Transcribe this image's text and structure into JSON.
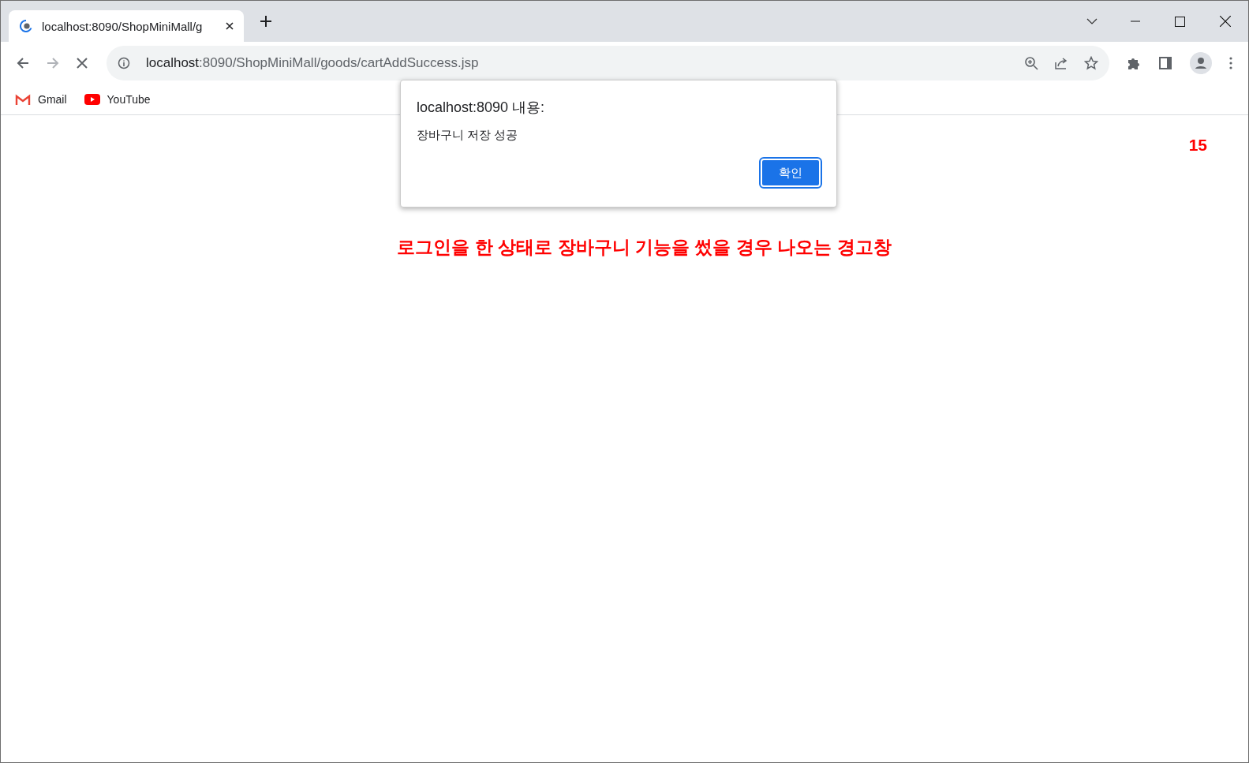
{
  "tabs": [
    {
      "title": "localhost:8090/ShopMiniMall/g",
      "selected": true
    }
  ],
  "address_bar": {
    "host": "localhost",
    "path": ":8090/ShopMiniMall/goods/cartAddSuccess.jsp"
  },
  "bookmarks": [
    {
      "label": "Gmail",
      "kind": "gmail"
    },
    {
      "label": "YouTube",
      "kind": "youtube"
    }
  ],
  "dialog": {
    "title": "localhost:8090 내용:",
    "message": "장바구니 저장 성공",
    "button": "확인"
  },
  "page": {
    "number": "15",
    "caption": "로그인을 한 상태로 장바구니 기능을 썼을 경우 나오는 경고창"
  }
}
